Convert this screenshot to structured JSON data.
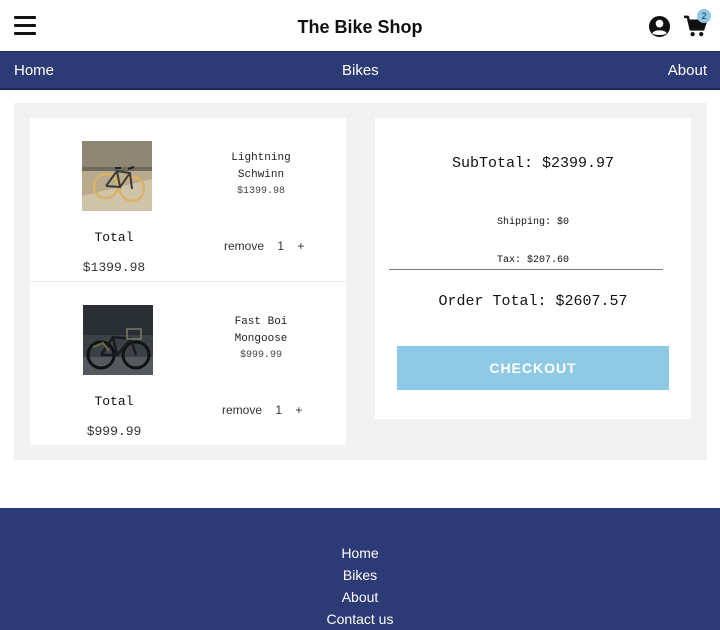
{
  "header": {
    "brand": "The Bike Shop",
    "cart_count": "2",
    "icons": [
      "menu-icon",
      "account-icon",
      "cart-icon"
    ]
  },
  "nav": {
    "home": "Home",
    "bikes": "Bikes",
    "about": "About"
  },
  "cart": {
    "items": [
      {
        "name_line1": "Lightning",
        "name_line2": "Schwinn",
        "price": "$1399.98",
        "total_label": "Total",
        "total_value": "$1399.98",
        "remove_label": "remove",
        "quantity": "1",
        "increment_label": "+"
      },
      {
        "name_line1": "Fast Boi",
        "name_line2": "Mongoose",
        "price": "$999.99",
        "total_label": "Total",
        "total_value": "$999.99",
        "remove_label": "remove",
        "quantity": "1",
        "increment_label": "+"
      }
    ]
  },
  "summary": {
    "subtotal": "SubTotal: $2399.97",
    "shipping": "Shipping: $0",
    "tax": "Tax: $207.60",
    "order_total": "Order Total: $2607.57",
    "checkout_label": "CHECKOUT"
  },
  "footer": {
    "links": [
      "Home",
      "Bikes",
      "About",
      "Contact us"
    ]
  },
  "colors": {
    "navy": "#2c3a75",
    "accent": "#8ecae6",
    "panel_bg": "#f1f1f1"
  }
}
